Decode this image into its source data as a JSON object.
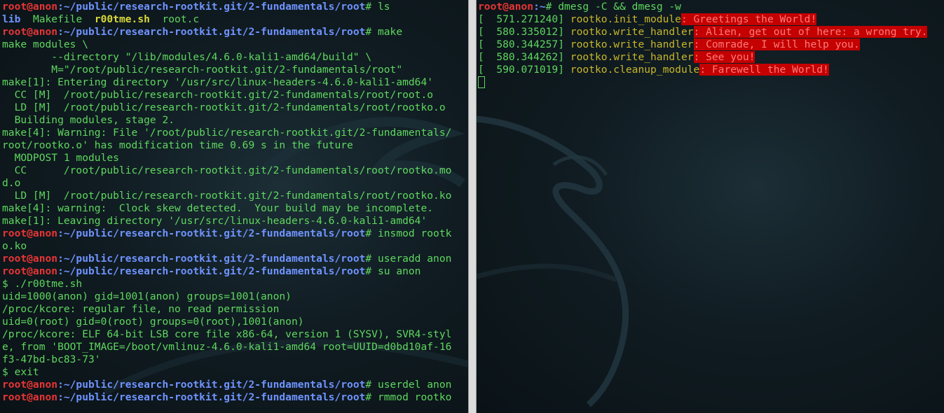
{
  "left_terminal": {
    "prompt_user": "root@anon",
    "prompt_path": ":~/public/research-rootkit.git/2-fundamentals/root",
    "prompt_suffix": "# ",
    "cmd_ls": "ls",
    "ls_items": [
      {
        "name": "lib",
        "kind": "dir"
      },
      {
        "name": "Makefile",
        "kind": "file"
      },
      {
        "name": "r00tme.sh",
        "kind": "exe"
      },
      {
        "name": "root.c",
        "kind": "file"
      }
    ],
    "cmd_make": "make",
    "make_output": [
      "make modules \\",
      "        --directory \"/lib/modules/4.6.0-kali1-amd64/build\" \\",
      "        M=\"/root/public/research-rootkit.git/2-fundamentals/root\"",
      "make[1]: Entering directory '/usr/src/linux-headers-4.6.0-kali1-amd64'",
      "  CC [M]  /root/public/research-rootkit.git/2-fundamentals/root/root.o",
      "  LD [M]  /root/public/research-rootkit.git/2-fundamentals/root/rootko.o",
      "  Building modules, stage 2.",
      "make[4]: Warning: File '/root/public/research-rootkit.git/2-fundamentals/",
      "root/rootko.o' has modification time 0.69 s in the future",
      "  MODPOST 1 modules",
      "  CC      /root/public/research-rootkit.git/2-fundamentals/root/rootko.mo",
      "d.o",
      "  LD [M]  /root/public/research-rootkit.git/2-fundamentals/root/rootko.ko",
      "make[4]: warning:  Clock skew detected.  Your build may be incomplete.",
      "make[1]: Leaving directory '/usr/src/linux-headers-4.6.0-kali1-amd64'"
    ],
    "cmd_insmod": "insmod rootk",
    "cmd_insmod_wrap": "o.ko",
    "cmd_useradd": "useradd anon",
    "cmd_su": "su anon",
    "user_session": [
      "$ ./r00tme.sh",
      "uid=1000(anon) gid=1001(anon) groups=1001(anon)",
      "/proc/kcore: regular file, no read permission",
      "uid=0(root) gid=0(root) groups=0(root),1001(anon)",
      "/proc/kcore: ELF 64-bit LSB core file x86-64, version 1 (SYSV), SVR4-styl",
      "e, from 'BOOT_IMAGE=/boot/vmlinuz-4.6.0-kali1-amd64 root=UUID=d0bd10af-16",
      "f3-47bd-bc83-73'",
      "$ exit"
    ],
    "cmd_userdel": "userdel anon",
    "cmd_rmmod": "rmmod rootko"
  },
  "right_terminal": {
    "prompt_user": "root@anon",
    "prompt_path": ":~",
    "prompt_suffix": "# ",
    "cmd": "dmesg -C && dmesg -w",
    "dmesg": [
      {
        "ts": "[  571.271240] ",
        "fn": "rootko.init_module",
        "msg": ": Greetings the World!"
      },
      {
        "ts": "[  580.335012] ",
        "fn": "rootko.write_handler",
        "msg": ": Alien, get out of here: a wrong try."
      },
      {
        "ts": "[  580.344257] ",
        "fn": "rootko.write_handler",
        "msg": ": Comrade, I will help you."
      },
      {
        "ts": "[  580.344262] ",
        "fn": "rootko.write_handler",
        "msg": ": See you!"
      },
      {
        "ts": "[  590.071019] ",
        "fn": "rootko.cleanup_module",
        "msg": ": Farewell the World!"
      }
    ]
  },
  "colors": {
    "prompt_user": "#e83535",
    "prompt_path": "#6f93ff",
    "output": "#5fd75f",
    "highlight_bg": "#c40000",
    "function_name": "#c8b62a"
  }
}
